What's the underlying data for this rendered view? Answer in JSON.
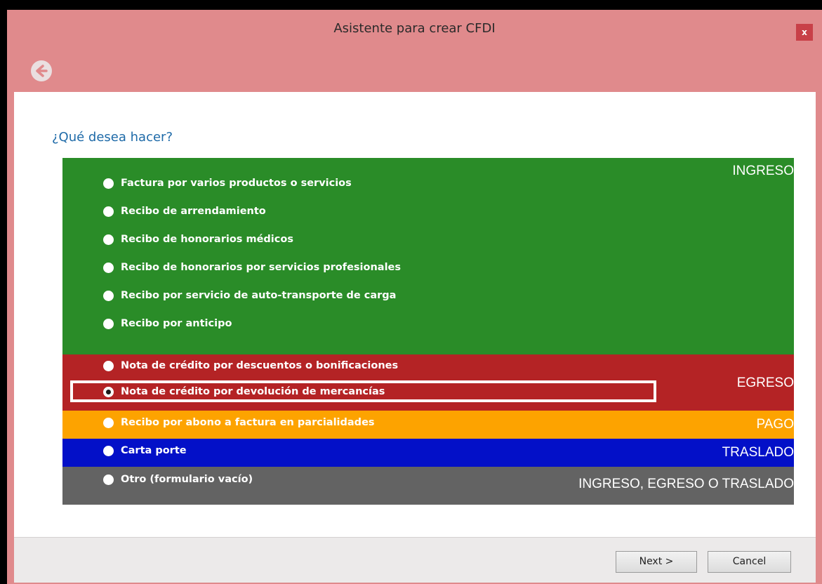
{
  "window": {
    "title": "Asistente para crear CFDI",
    "close_label": "x"
  },
  "question": "¿Qué desea hacer?",
  "categories": {
    "ingreso": "INGRESO",
    "egreso": "EGRESO",
    "pago": "PAGO",
    "traslado": "TRASLADO",
    "otro": "INGRESO, EGRESO O TRASLADO"
  },
  "options": {
    "ingreso": [
      "Factura por varios productos o servicios",
      "Recibo de arrendamiento",
      "Recibo de honorarios médicos",
      "Recibo de honorarios por servicios profesionales",
      "Recibo por servicio de auto-transporte de carga",
      "Recibo por anticipo"
    ],
    "egreso": [
      "Nota de crédito por descuentos o bonificaciones",
      "Nota de crédito por devolución de mercancías"
    ],
    "pago": [
      "Recibo por abono a factura en parcialidades"
    ],
    "traslado": [
      "Carta porte"
    ],
    "otro": [
      "Otro (formulario vacío)"
    ]
  },
  "selected_option": "Nota de crédito por devolución de mercancías",
  "buttons": {
    "next": "Next >",
    "cancel": "Cancel"
  },
  "colors": {
    "ingreso": "#2a8c28",
    "egreso": "#b42325",
    "pago": "#fda300",
    "traslado": "#0310c8",
    "otro": "#636363",
    "window_frame": "#e08a8c"
  }
}
